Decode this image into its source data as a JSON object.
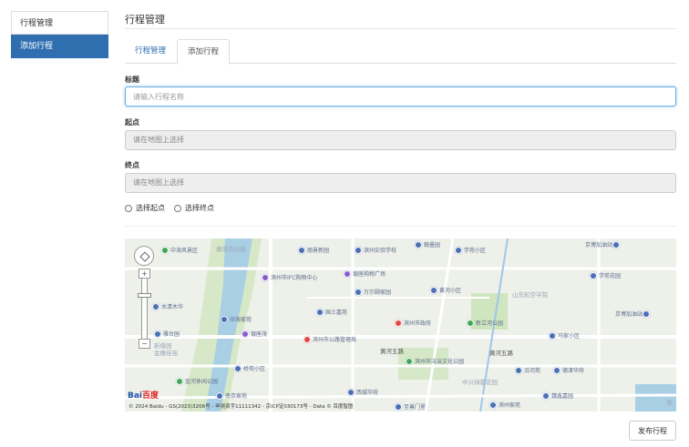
{
  "sidebar": {
    "items": [
      {
        "label": "行程管理",
        "active": false
      },
      {
        "label": "添加行程",
        "active": true
      }
    ]
  },
  "main": {
    "title": "行程管理",
    "tabs": [
      {
        "label": "行程管理",
        "active": false
      },
      {
        "label": "添加行程",
        "active": true
      }
    ],
    "form": {
      "title_label": "标题",
      "title_placeholder": "请输入行程名称",
      "start_label": "起点",
      "start_value": "请在地图上选择",
      "end_label": "终点",
      "end_value": "请在地图上选择",
      "radio_start": "选择起点",
      "radio_end": "选择终点"
    },
    "map": {
      "pois": [
        "中海风景区",
        "黄璟湾公园",
        "丽景新园",
        "滨州实验学校",
        "翰墨园",
        "学苑小区",
        "京博加油站",
        "滨州市IFC购物中心",
        "银座购物广场",
        "万尔颐家园",
        "黄河小区",
        "山东航空学院",
        "学苑花园",
        "水清木华",
        "中海家苑",
        "国土嘉苑",
        "滨州市政府",
        "新立河公园",
        "京博加油站",
        "雅台园",
        "新缘园",
        "金穗佳苑",
        "银座茂",
        "滨州市公路管理局",
        "黄河五路",
        "黄河五路",
        "马家小区",
        "滨州市法治文化公园",
        "沿河苑",
        "德津华府",
        "桥苑小区",
        "中兴绿都花园",
        "金河休闲公园",
        "南京家苑",
        "西城华府",
        "至善门里",
        "滨州家苑",
        "魏鑫嘉园",
        "渤"
      ],
      "copyright": "© 2024 Baidu - GS(2023)3206号 - 甲测资字11111342 - 京ICP证030173号 - Data © 百度智图",
      "logo_text": "Bai",
      "logo_suffix": "百度",
      "zoom_in": "+",
      "zoom_out": "−"
    },
    "publish_label": "发布行程"
  }
}
